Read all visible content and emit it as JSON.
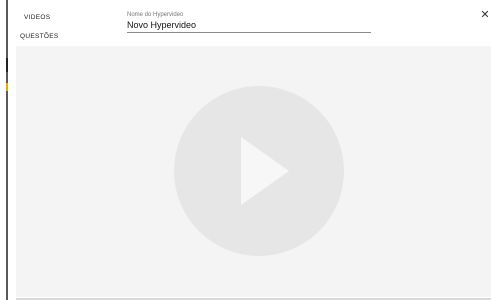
{
  "nav": {
    "items": [
      {
        "label": "VIDEOS"
      },
      {
        "label": "QUESTÕES"
      }
    ]
  },
  "name_field": {
    "label": "Nome do Hypervideo",
    "value": "Novo Hypervideo"
  },
  "close_button": {
    "label": "✕"
  },
  "player": {
    "icon": "play-icon"
  },
  "colors": {
    "player_background": "#f4f4f4",
    "play_circle": "#e6e6e6",
    "play_triangle": "#f7f7f7"
  }
}
